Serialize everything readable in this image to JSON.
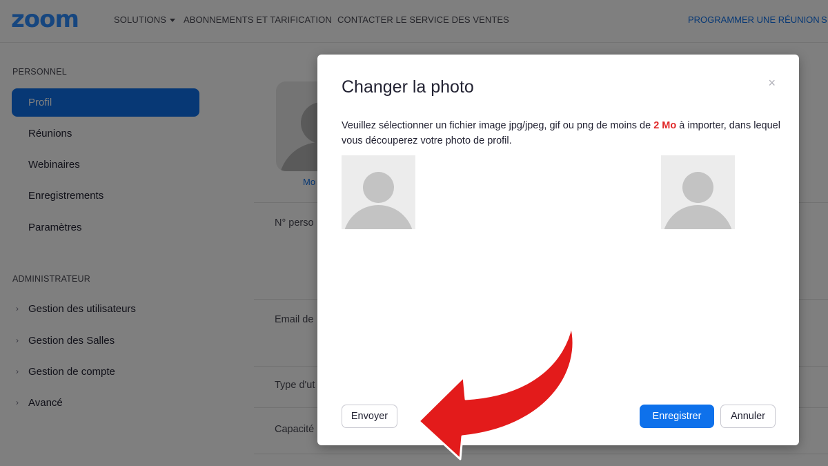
{
  "header": {
    "logo_text": "zoom",
    "nav": [
      {
        "label": "SOLUTIONS",
        "has_dropdown": true
      },
      {
        "label": "ABONNEMENTS ET TARIFICATION"
      },
      {
        "label": "CONTACTER LE SERVICE DES VENTES"
      }
    ],
    "right_link": "PROGRAMMER UNE RÉUNION",
    "right_link_cut": "S"
  },
  "sidebar": {
    "personal_title": "PERSONNEL",
    "personal_items": [
      "Profil",
      "Réunions",
      "Webinaires",
      "Enregistrements",
      "Paramètres"
    ],
    "admin_title": "ADMINISTRATEUR",
    "admin_items": [
      "Gestion des utilisateurs",
      "Gestion des Salles",
      "Gestion de compte",
      "Avancé"
    ]
  },
  "background": {
    "change_link": "Mo",
    "labels": [
      "N° perso",
      "Email de",
      "Type d'ut",
      "Capacité"
    ]
  },
  "modal": {
    "title": "Changer la photo",
    "close_glyph": "×",
    "text_before": "Veuillez sélectionner un fichier image jpg/jpeg, gif ou png de moins de ",
    "text_highlight": "2 Mo",
    "text_after": " à importer, dans lequel vous découperez votre photo de profil.",
    "send_label": "Envoyer",
    "save_label": "Enregistrer",
    "cancel_label": "Annuler"
  },
  "colors": {
    "brand": "#2D8CFF",
    "primary": "#0E71EB",
    "highlight_red": "#e02828",
    "arrow_red": "#e31b1b",
    "overlay": "rgba(0,0,0,0.5)"
  },
  "icons": {
    "close": "close-icon",
    "chevron": "chevron-right-icon",
    "caret": "caret-down-icon",
    "avatar": "avatar-placeholder-icon",
    "annotation": "curved-arrow-icon"
  }
}
